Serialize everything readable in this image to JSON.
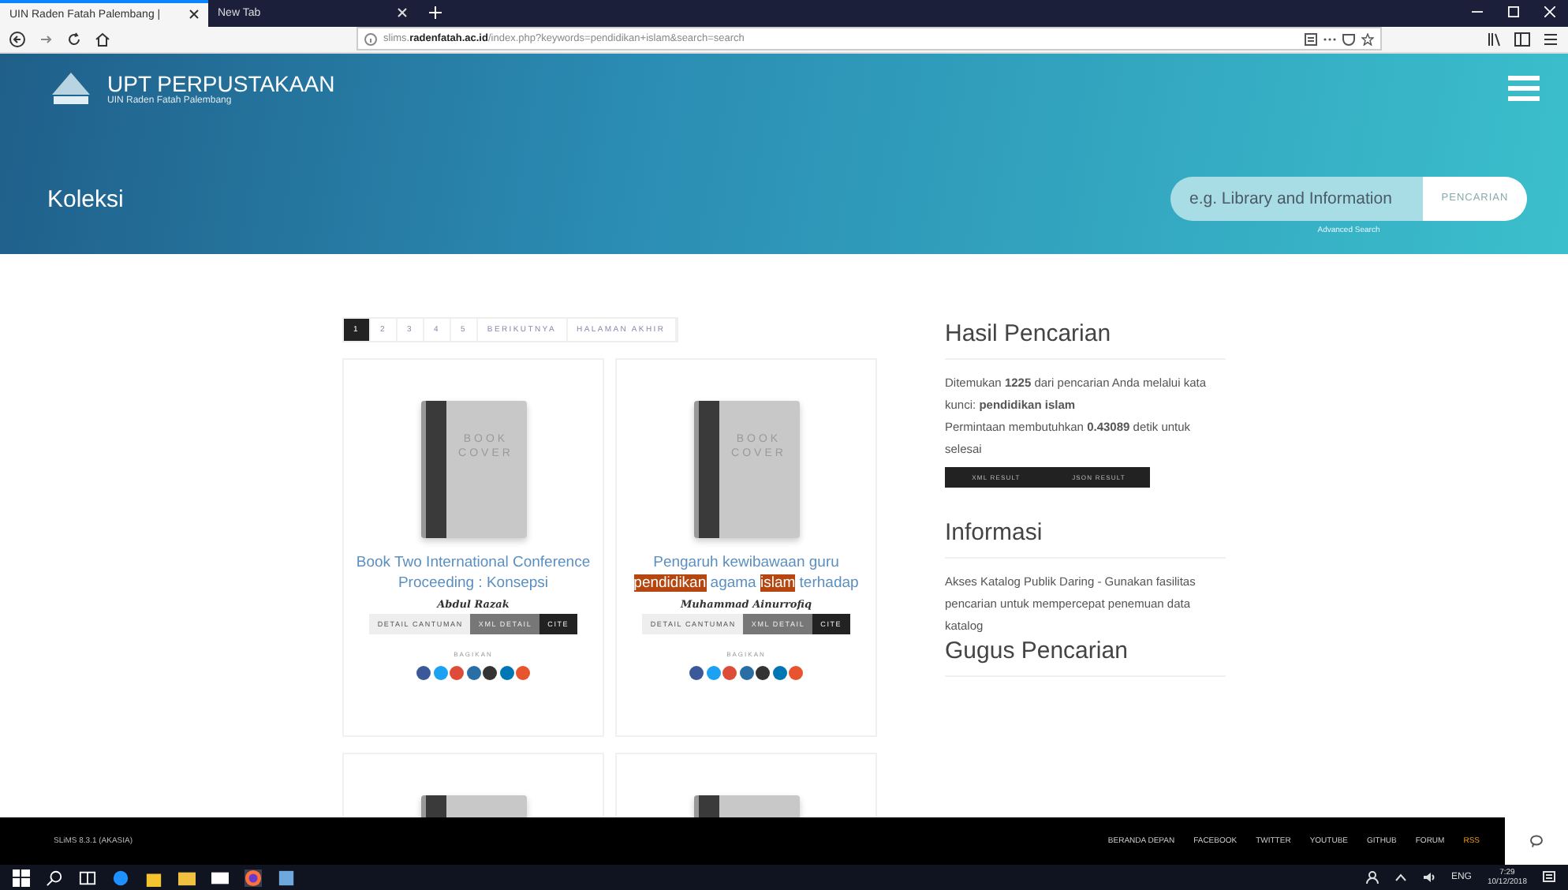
{
  "browser": {
    "tabs": [
      {
        "label": "UIN Raden Fatah Palembang | ",
        "selected": true
      },
      {
        "label": "New Tab",
        "selected": false
      }
    ],
    "url": {
      "prefix": "slims.",
      "host": "radenfatah.ac.id",
      "path": "/index.php?keywords=pendidikan+islam&search=search"
    }
  },
  "header": {
    "title": "UPT PERPUSTAKAAN",
    "subtitle": "UIN Raden Fatah Palembang",
    "page_title": "Koleksi",
    "search": {
      "placeholder": "e.g. Library and Information",
      "button": "PENCARIAN",
      "advanced": "Advanced Search"
    }
  },
  "pagination": [
    {
      "label": "1",
      "selected": true
    },
    {
      "label": "2",
      "selected": false
    },
    {
      "label": "3",
      "selected": false
    },
    {
      "label": "4",
      "selected": false
    },
    {
      "label": "5",
      "selected": false
    },
    {
      "label": "BERIKUTNYA",
      "selected": false
    },
    {
      "label": "HALAMAN AKHIR",
      "selected": false
    }
  ],
  "cards": [
    {
      "cover_text": [
        "BOOK",
        "COVER"
      ],
      "title": [
        {
          "text": "Book Two International Conference Proceeding : Konsepsi",
          "highlight": false
        }
      ],
      "author": "Abdul Razak",
      "buttons": [
        "DETAIL CANTUMAN",
        "XML DETAIL",
        "CITE"
      ],
      "share_label": "BAGIKAN",
      "share_icons": [
        {
          "color": "#3b5998"
        },
        {
          "color": "#1da1f2"
        },
        {
          "color": "#dd4b39"
        },
        {
          "color": "#2a6ea6"
        },
        {
          "color": "#333333"
        },
        {
          "color": "#0077b5"
        },
        {
          "color": "#e8542d"
        }
      ]
    },
    {
      "cover_text": [
        "BOOK",
        "COVER"
      ],
      "title": [
        {
          "text": "Pengaruh kewibawaan guru",
          "highlight": false
        },
        {
          "text": "pendidikan",
          "highlight": true
        },
        {
          "text": "agama",
          "highlight": false
        },
        {
          "text": "islam",
          "highlight": true
        },
        {
          "text": "terhadap",
          "highlight": false
        }
      ],
      "author": "Muhammad Ainurrofiq",
      "buttons": [
        "DETAIL CANTUMAN",
        "XML DETAIL",
        "CITE"
      ],
      "share_label": "BAGIKAN",
      "share_icons": [
        {
          "color": "#3b5998"
        },
        {
          "color": "#1da1f2"
        },
        {
          "color": "#dd4b39"
        },
        {
          "color": "#2a6ea6"
        },
        {
          "color": "#333333"
        },
        {
          "color": "#0077b5"
        },
        {
          "color": "#e8542d"
        }
      ]
    }
  ],
  "sidebar": {
    "results_title": "Hasil Pencarian",
    "results_text": [
      "Ditemukan **1225** dari pencarian Anda melalui kata kunci: **pendidikan islam**",
      "Permintaan membutuhkan **0.43089** detik untuk selesai"
    ],
    "result_buttons": [
      "XML RESULT",
      "JSON RESULT"
    ],
    "info_title": "Informasi",
    "info_text": "Akses Katalog Publik Daring - Gunakan fasilitas pencarian untuk mempercepat penemuan data katalog",
    "cluster_title": "Gugus Pencarian"
  },
  "footer": {
    "version": "SLiMS 8.3.1 (AKASIA)",
    "links": [
      {
        "label": "BERANDA DEPAN",
        "accent": false
      },
      {
        "label": "FACEBOOK",
        "accent": false
      },
      {
        "label": "TWITTER",
        "accent": false
      },
      {
        "label": "YOUTUBE",
        "accent": false
      },
      {
        "label": "GITHUB",
        "accent": false
      },
      {
        "label": "FORUM",
        "accent": false
      },
      {
        "label": "RSS",
        "accent": true
      }
    ]
  },
  "taskbar": {
    "language": "ENG",
    "time": "7:29",
    "date": "10/12/2018"
  }
}
